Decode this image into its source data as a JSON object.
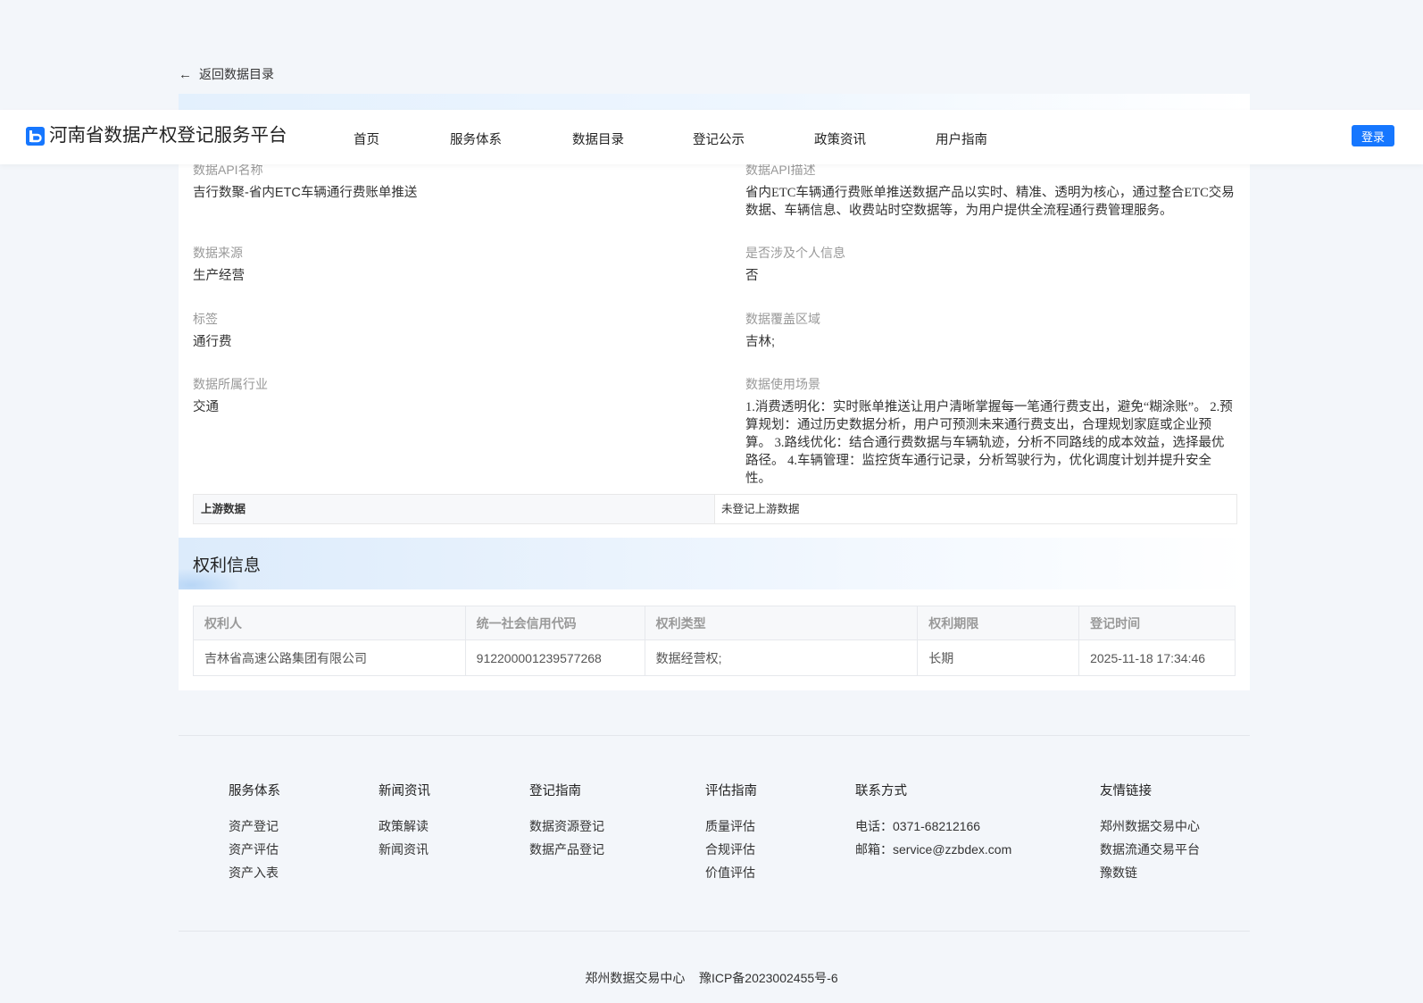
{
  "back_link": {
    "label": "返回数据目录"
  },
  "header": {
    "site_title": "河南省数据产权登记服务平台",
    "nav": [
      "首页",
      "服务体系",
      "数据目录",
      "登记公示",
      "政策资讯",
      "用户指南"
    ],
    "login_label": "登录",
    "accent_color": "#1677ff"
  },
  "details": {
    "api_name": {
      "label": "数据API名称",
      "value": "吉行数聚-省内ETC车辆通行费账单推送"
    },
    "api_desc": {
      "label": "数据API描述",
      "value": "省内ETC车辆通行费账单推送数据产品以实时、精准、透明为核心，通过整合ETC交易数据、车辆信息、收费站时空数据等，为用户提供全流程通行费管理服务。"
    },
    "source": {
      "label": "数据来源",
      "value": "生产经营"
    },
    "personal_info": {
      "label": "是否涉及个人信息",
      "value": "否"
    },
    "tags": {
      "label": "标签",
      "value": "通行费"
    },
    "coverage": {
      "label": "数据覆盖区域",
      "value": "吉林;"
    },
    "industry": {
      "label": "数据所属行业",
      "value": "交通"
    },
    "scenario": {
      "label": "数据使用场景",
      "value": "1.消费透明化：实时账单推送让用户清晰掌握每一笔通行费支出，避免“糊涂账”。 2.预算规划：通过历史数据分析，用户可预测未来通行费支出，合理规划家庭或企业预算。 3.路线优化：结合通行费数据与车辆轨迹，分析不同路线的成本效益，选择最优路径。 4.车辆管理：监控货车通行记录，分析驾驶行为，优化调度计划并提升安全性。"
    }
  },
  "upstream": {
    "label": "上游数据",
    "value": "未登记上游数据"
  },
  "rights": {
    "title": "权利信息",
    "columns": [
      "权利人",
      "统一社会信用代码",
      "权利类型",
      "权利期限",
      "登记时间"
    ],
    "rows": [
      [
        "吉林省高速公路集团有限公司",
        "912200001239577268",
        "数据经营权;",
        "长期",
        "2025-11-18 17:34:46"
      ]
    ]
  },
  "footer": {
    "columns": [
      {
        "heading": "服务体系",
        "links": [
          "资产登记",
          "资产评估",
          "资产入表"
        ]
      },
      {
        "heading": "新闻资讯",
        "links": [
          "政策解读",
          "新闻资讯"
        ]
      },
      {
        "heading": "登记指南",
        "links": [
          "数据资源登记",
          "数据产品登记"
        ]
      },
      {
        "heading": "评估指南",
        "links": [
          "质量评估",
          "合规评估",
          "价值评估"
        ]
      },
      {
        "heading": "联系方式",
        "links": [
          "电话：0371-68212166",
          "邮箱：service@zzbdex.com"
        ]
      },
      {
        "heading": "友情链接",
        "links": [
          "郑州数据交易中心",
          "数据流通交易平台",
          "豫数链"
        ]
      }
    ],
    "copyright_org": "郑州数据交易中心",
    "icp": "豫ICP备2023002455号-6"
  }
}
